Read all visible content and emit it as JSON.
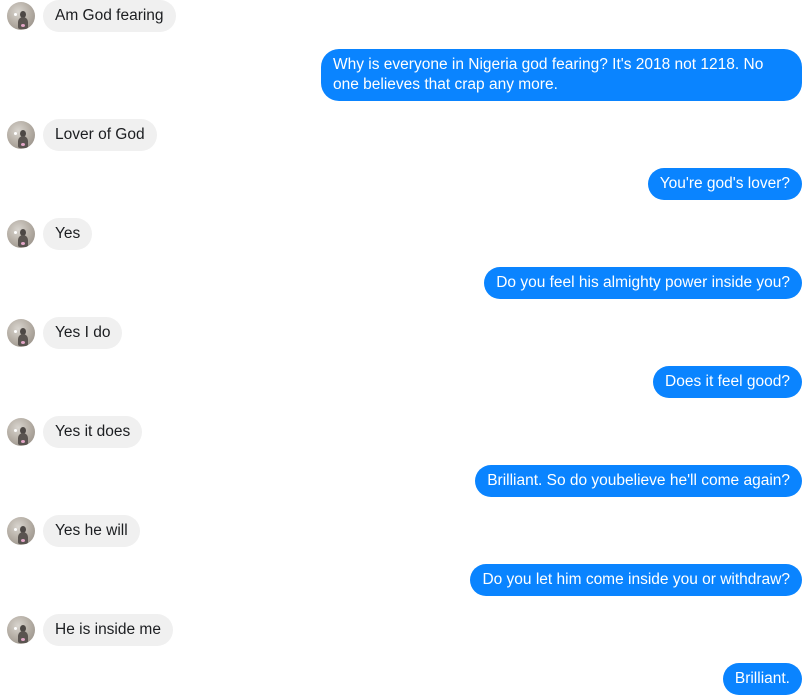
{
  "conversation": {
    "messages": [
      {
        "from": "them",
        "text": "Am God fearing"
      },
      {
        "from": "me",
        "text": "Why is everyone in Nigeria god fearing? It's 2018 not 1218. No one believes that crap any more."
      },
      {
        "from": "them",
        "text": "Lover of God"
      },
      {
        "from": "me",
        "text": "You're god's lover?"
      },
      {
        "from": "them",
        "text": "Yes"
      },
      {
        "from": "me",
        "text": "Do you feel his almighty power inside you?"
      },
      {
        "from": "them",
        "text": "Yes I do"
      },
      {
        "from": "me",
        "text": "Does it feel good?"
      },
      {
        "from": "them",
        "text": "Yes it does"
      },
      {
        "from": "me",
        "text": "Brilliant. So do youbelieve he'll come again?"
      },
      {
        "from": "them",
        "text": "Yes he will"
      },
      {
        "from": "me",
        "text": "Do you let him come inside you or withdraw?"
      },
      {
        "from": "them",
        "text": "He is inside me"
      },
      {
        "from": "me",
        "text": "Brilliant."
      }
    ]
  },
  "colors": {
    "outgoing_bubble": "#0a84ff",
    "incoming_bubble": "#f0f0f0",
    "outgoing_text": "#ffffff",
    "incoming_text": "#1c1e21"
  },
  "icons": {
    "contact_avatar": "avatar-icon"
  }
}
